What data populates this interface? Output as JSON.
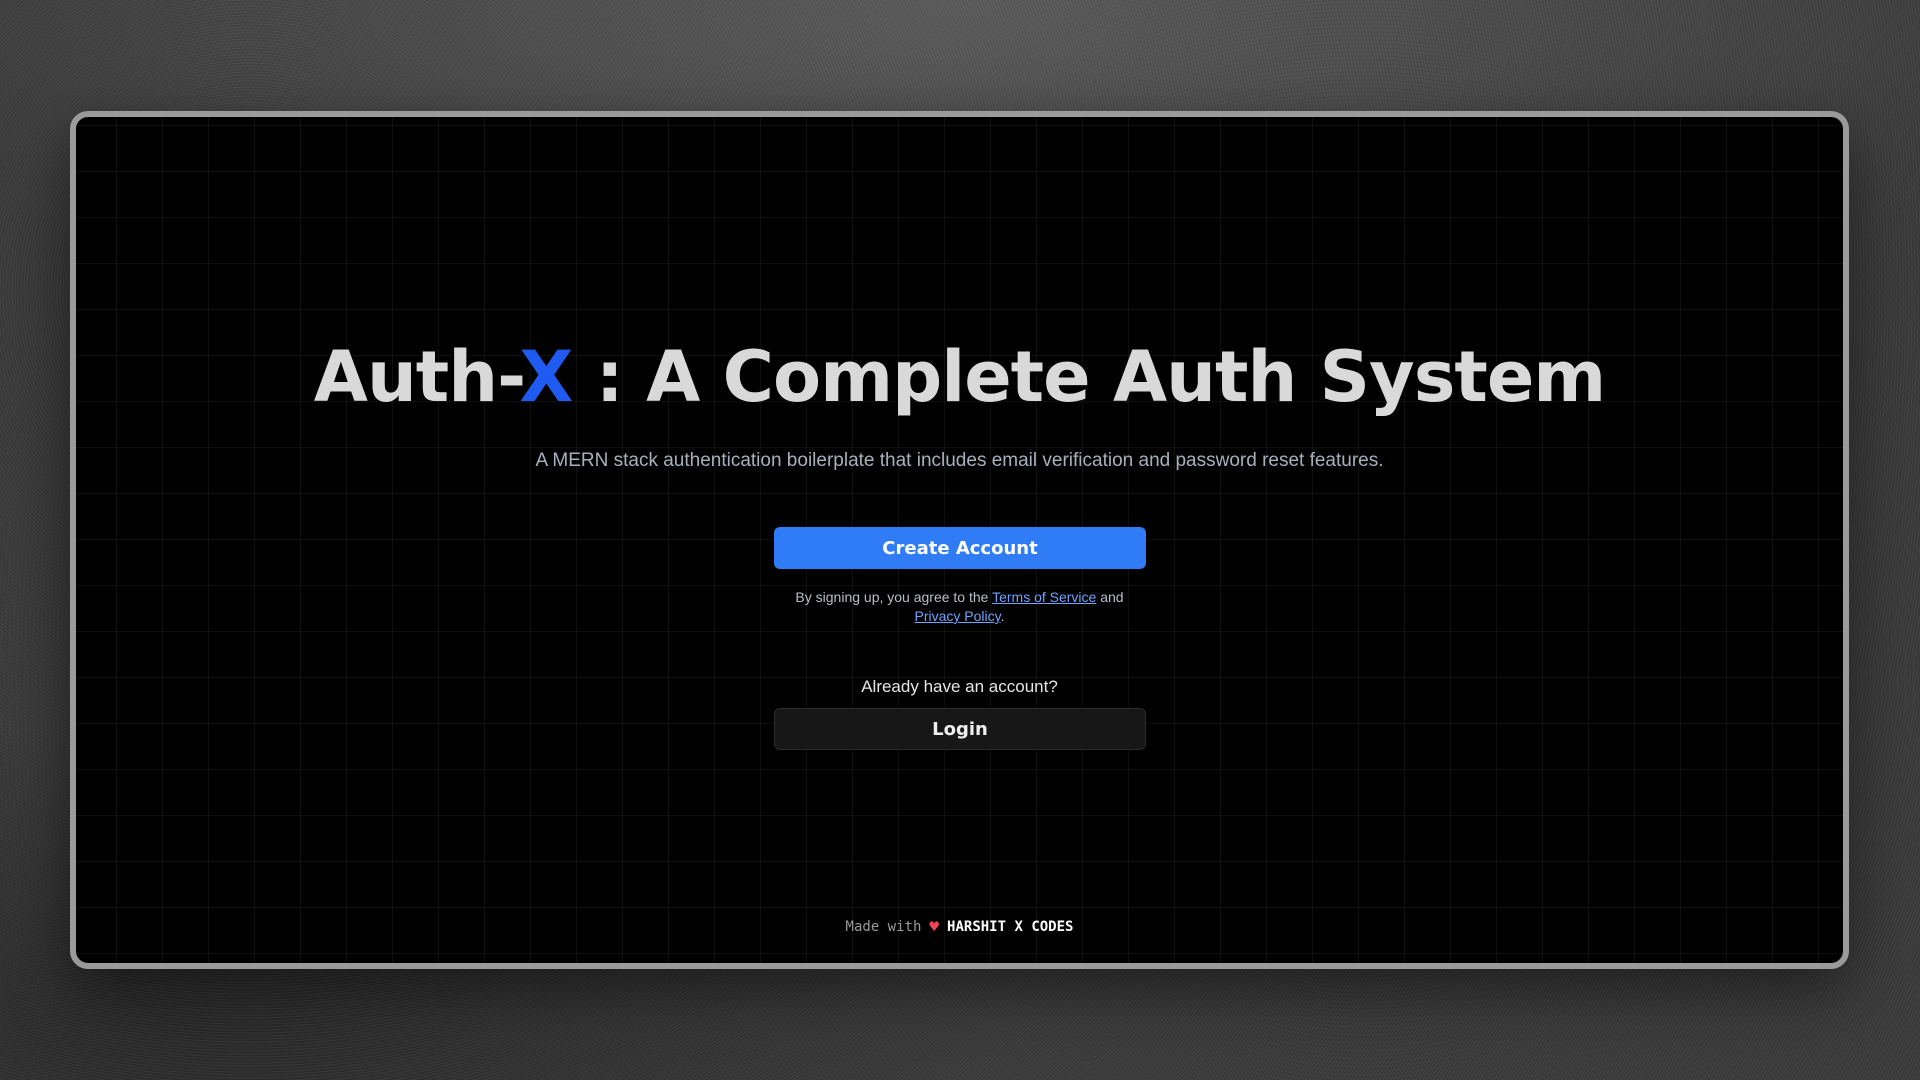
{
  "hero": {
    "title_prefix": "Auth-",
    "title_accent": "X",
    "title_suffix": " : A Complete Auth System",
    "subtitle": "A MERN stack authentication boilerplate that includes email verification and password reset features."
  },
  "signup": {
    "create_account_label": "Create Account",
    "terms_prefix": "By signing up, you agree to the ",
    "terms_link": "Terms of Service",
    "terms_and": " and",
    "privacy_link": "Privacy Policy",
    "terms_end": "."
  },
  "login": {
    "prompt": "Already have an account?",
    "login_label": "Login"
  },
  "footer": {
    "made_with": "Made with",
    "heart_icon": "♥",
    "brand": "HARSHIT X CODES"
  },
  "colors": {
    "accent": "#1f5bf0",
    "primary_button": "#2f7cf6",
    "link": "#6ea3ff",
    "heart": "#f0445a"
  }
}
